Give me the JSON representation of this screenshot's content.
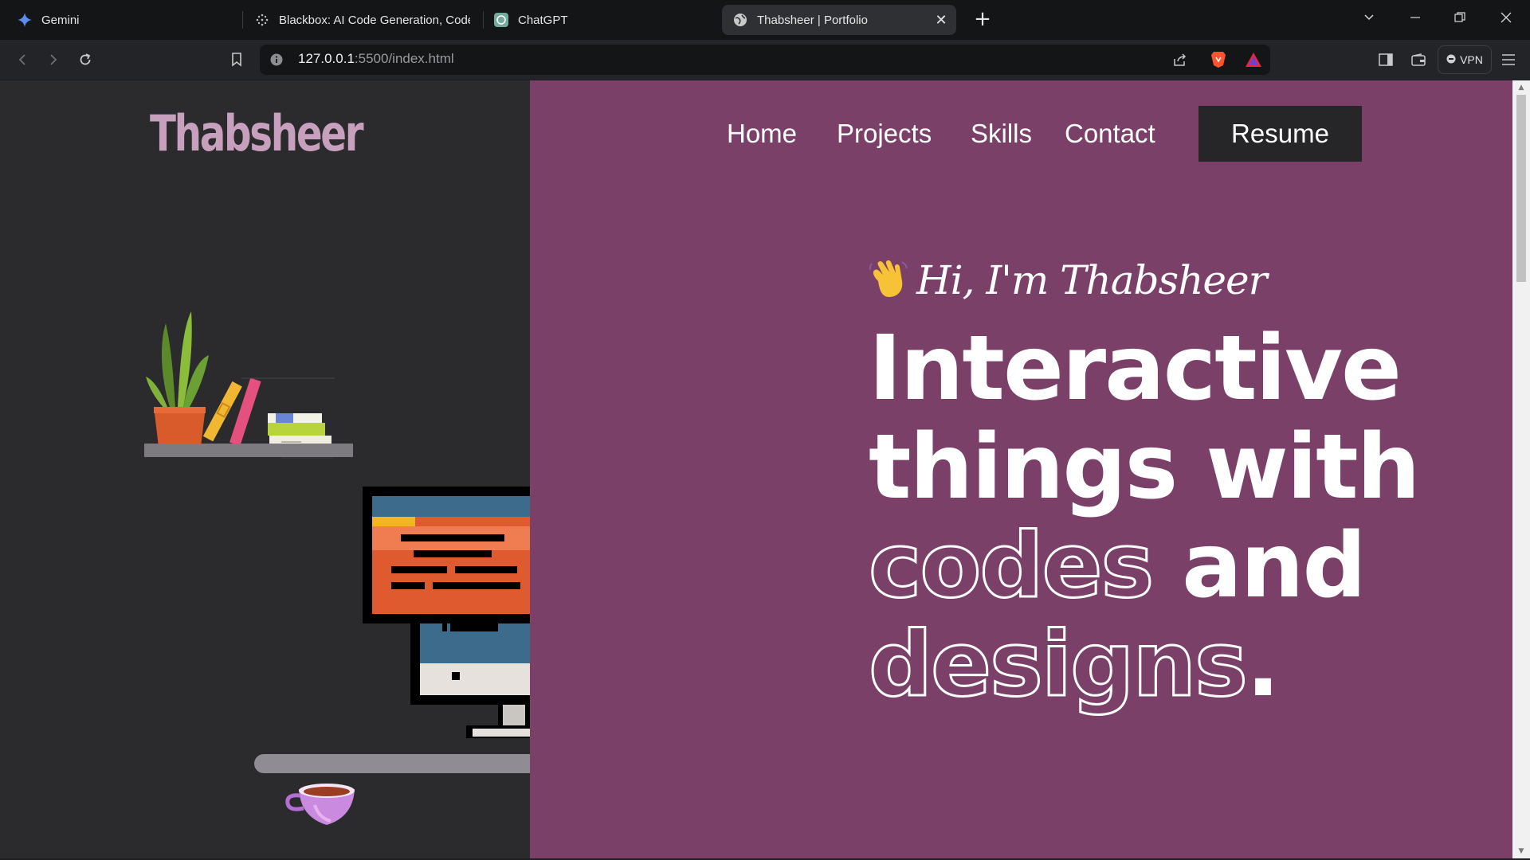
{
  "browser": {
    "tabs": [
      {
        "title": "Gemini"
      },
      {
        "title": "Blackbox: AI Code Generation, Code"
      },
      {
        "title": "ChatGPT"
      },
      {
        "title": "Thabsheer | Portfolio"
      }
    ],
    "new_tab_symbol": "+",
    "close_symbol": "✕",
    "url_host": "127.0.0.1",
    "url_rest": ":5500/index.html",
    "vpn_label": "VPN"
  },
  "page": {
    "logo": "Thabsheer",
    "nav": {
      "home": "Home",
      "projects": "Projects",
      "skills": "Skills",
      "contact": "Contact",
      "resume": "Resume"
    },
    "greeting_emoji": "👋",
    "greeting": "Hi, I'm Thabsheer",
    "headline": {
      "line1": "Interactive",
      "line2": "things with",
      "line3_outline": "codes",
      "line3_solid": "and",
      "line4_outline": "designs",
      "line4_period": "."
    },
    "colors": {
      "left_bg": "#2b2a2c",
      "right_bg": "#7a4068",
      "logo": "#c6a0bd",
      "resume_bg": "#262527"
    }
  }
}
